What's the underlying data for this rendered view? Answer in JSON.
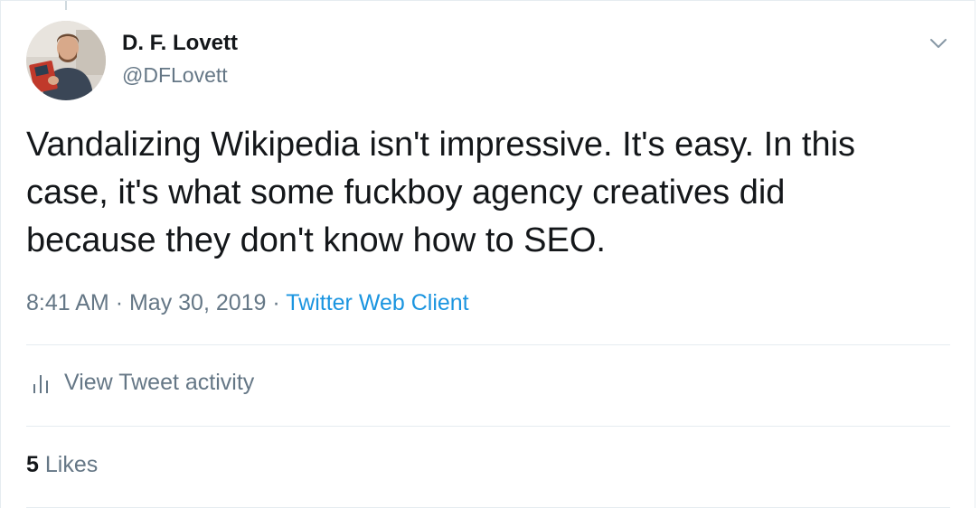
{
  "author": {
    "name": "D. F. Lovett",
    "handle": "@DFLovett"
  },
  "tweet": {
    "lines": [
      "Vandalizing Wikipedia isn't impressive. It's easy. In this",
      "case, it's what some fuckboy agency creatives did",
      "because they don't know how to SEO."
    ],
    "time": "8:41 AM",
    "separator": "·",
    "date": "May 30, 2019",
    "source": "Twitter Web Client"
  },
  "activity": {
    "label": "View Tweet activity",
    "icon": "bar-chart-icon"
  },
  "likes": {
    "count": "5",
    "label": "Likes"
  },
  "menu": {
    "icon": "chevron-down-icon"
  },
  "colors": {
    "text": "#14171a",
    "secondary": "#657786",
    "link": "#1b95e0",
    "divider": "#e6ecf0"
  }
}
